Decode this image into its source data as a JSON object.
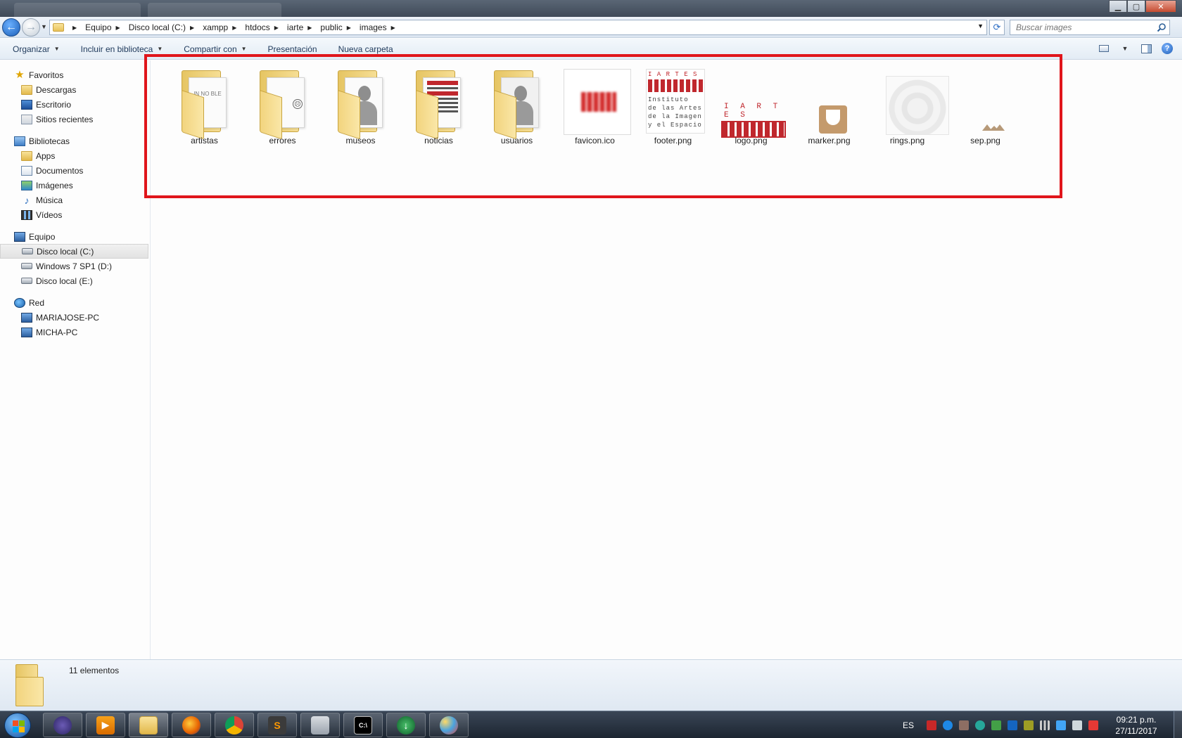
{
  "address_bar": {
    "crumbs": [
      "Equipo",
      "Disco local (C:)",
      "xampp",
      "htdocs",
      "iarte",
      "public",
      "images"
    ]
  },
  "search": {
    "placeholder": "Buscar images"
  },
  "toolbar": {
    "organize": "Organizar",
    "include_library": "Incluir en biblioteca",
    "share_with": "Compartir con",
    "slideshow": "Presentación",
    "new_folder": "Nueva carpeta"
  },
  "sidebar": {
    "favorites": {
      "label": "Favoritos",
      "items": [
        "Descargas",
        "Escritorio",
        "Sitios recientes"
      ]
    },
    "libraries": {
      "label": "Bibliotecas",
      "items": [
        "Apps",
        "Documentos",
        "Imágenes",
        "Música",
        "Vídeos"
      ]
    },
    "computer": {
      "label": "Equipo",
      "items": [
        "Disco local (C:)",
        "Windows 7 SP1 (D:)",
        "Disco local (E:)"
      ],
      "selected": "Disco local (C:)"
    },
    "network": {
      "label": "Red",
      "items": [
        "MARIAJOSE-PC",
        "MICHA-PC"
      ]
    }
  },
  "files": [
    {
      "name": "artistas",
      "type": "folder"
    },
    {
      "name": "errores",
      "type": "folder"
    },
    {
      "name": "museos",
      "type": "folder"
    },
    {
      "name": "noticias",
      "type": "folder"
    },
    {
      "name": "usuarios",
      "type": "folder"
    },
    {
      "name": "favicon.ico",
      "type": "image"
    },
    {
      "name": "footer.png",
      "type": "image"
    },
    {
      "name": "logo.png",
      "type": "image"
    },
    {
      "name": "marker.png",
      "type": "image"
    },
    {
      "name": "rings.png",
      "type": "image"
    },
    {
      "name": "sep.png",
      "type": "image"
    }
  ],
  "thumb_text": {
    "artistas": "IN NO BLE",
    "iartes": "I A R T E S",
    "footer_lines": [
      "Instituto",
      "de las Artes",
      "de la Imagen",
      "y el Espacio"
    ]
  },
  "status": {
    "count": "11 elementos"
  },
  "taskbar": {
    "lang": "ES",
    "time": "09:21 p.m.",
    "date": "27/11/2017"
  },
  "colors": {
    "highlight": "#e0151b",
    "brand_red": "#c0272d"
  }
}
